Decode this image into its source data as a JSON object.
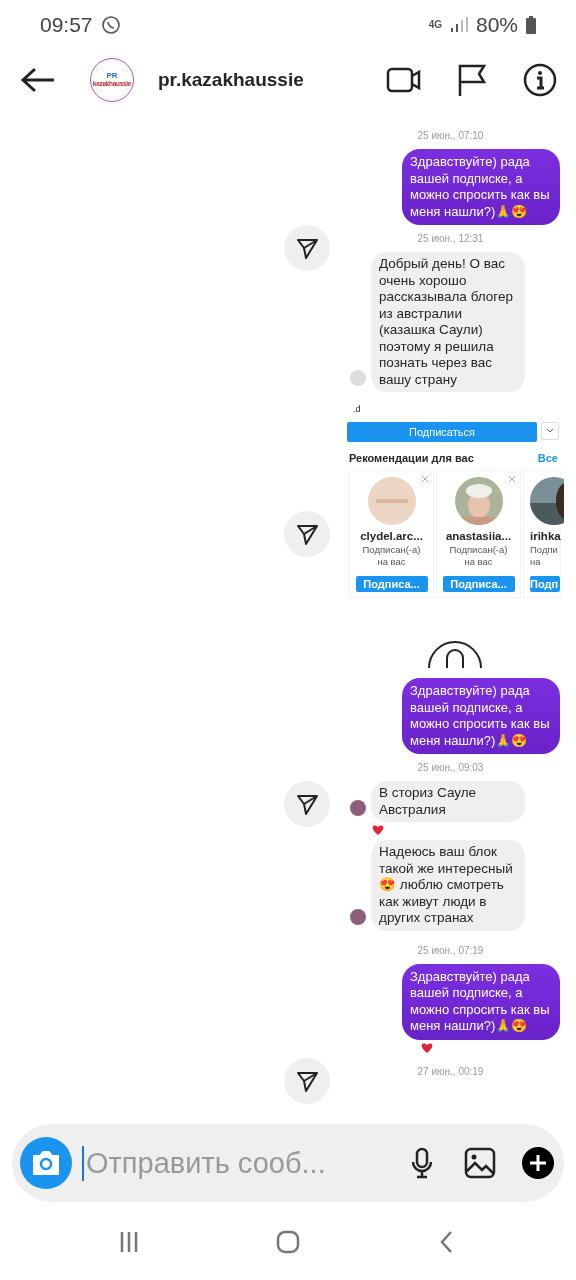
{
  "status_bar": {
    "time": "09:57",
    "network": "4G",
    "battery": "80%"
  },
  "header": {
    "avatar_lines": [
      "PR",
      "kazakhaussie"
    ],
    "username": "pr.kazakhaussie"
  },
  "chat": [
    {
      "share": false,
      "items": [
        {
          "kind": "date",
          "text": "25 июн., 07:10"
        },
        {
          "kind": "sent",
          "text": "Здравствуйте) рада вашей подписке, а можно спросить  как вы меня нашли?)🙏😍",
          "reacted": false
        }
      ]
    },
    {
      "share": true,
      "items": [
        {
          "kind": "date",
          "text": "25 июн., 12:31"
        },
        {
          "kind": "received",
          "text": "Добрый день! О вас очень хорошо рассказывала блогер из австралии (казашка Саули) поэтому я решила познать через вас вашу страну",
          "color": "#dddddd",
          "reacted": false
        }
      ]
    },
    {
      "share": false,
      "items": [
        {
          "kind": "profile",
          "handle": ".d",
          "follow": "Подписаться",
          "recs_title": "Рекомендации для вас",
          "recs_all": "Все"
        }
      ]
    },
    {
      "share": true,
      "items": [
        {
          "kind": "cards",
          "cards": [
            {
              "name": "clydel.arc...",
              "subtitle": "Подписан(-а) на вас",
              "button": "Подписа...",
              "closable": true
            },
            {
              "name": "anastasiia...",
              "subtitle": "Подписан(-а) на вас",
              "button": "Подписа...",
              "closable": true
            },
            {
              "name": "irihka",
              "subtitle": "Подпи на",
              "button": "Подп",
              "closable": false
            }
          ]
        }
      ]
    },
    {
      "share": false,
      "items": [
        {
          "kind": "profile_icon"
        },
        {
          "kind": "sent",
          "text": "Здравствуйте) рада вашей подписке, а можно спросить  как вы меня нашли?)🙏😍",
          "reacted": false
        },
        {
          "kind": "date",
          "text": "25 июн., 09:03"
        }
      ]
    },
    {
      "share": true,
      "items": [
        {
          "kind": "received",
          "text": "В сториз Сауле Австралия",
          "color": "#8e5f7a",
          "reacted": true
        },
        {
          "kind": "received",
          "text": "Надеюсь ваш блок такой же интересный 😍 люблю смотреть как живут люди в других странах",
          "color": "#8e5f7a",
          "reacted": false
        }
      ]
    },
    {
      "share": false,
      "items": [
        {
          "kind": "date",
          "text": "25 июн., 07:19"
        },
        {
          "kind": "sent",
          "text": "Здравствуйте) рада вашей подписке, а можно спросить  как вы меня нашли?)🙏😍",
          "reacted": true
        }
      ]
    },
    {
      "share": true,
      "items": [
        {
          "kind": "date",
          "text": "27 июн., 00:19"
        }
      ]
    }
  ],
  "composer": {
    "placeholder": "Отправить сооб..."
  }
}
